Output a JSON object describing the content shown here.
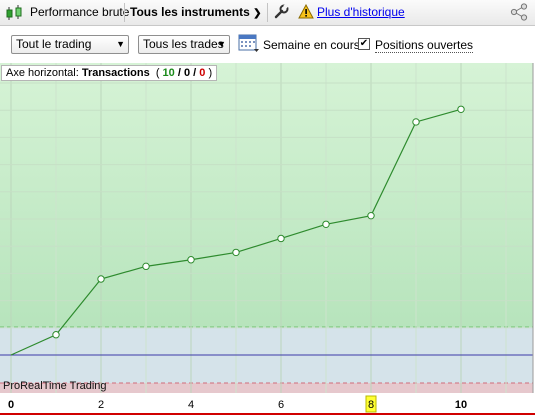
{
  "toolbar": {
    "performance_label": "Performance brute",
    "instruments_label": "Tous les instruments",
    "history_link": "Plus d'historique"
  },
  "filters": {
    "trading_select": "Tout le trading",
    "trades_select": "Tous les trades",
    "period_label": "Semaine en cours",
    "open_positions_label": "Positions ouvertes",
    "open_positions_checked": true
  },
  "legend": {
    "axis_prefix": "Axe horizontal:",
    "axis_name": "Transactions",
    "open_paren": "(",
    "wins": "10",
    "slash1": "/",
    "neutral": "0",
    "slash2": "/",
    "losses": "0",
    "close_paren": ")"
  },
  "panel_label": "ProRealTime Trading",
  "colors": {
    "win": "#1a8a1a",
    "loss": "#cc0000",
    "line": "#2e8b2e",
    "zero_line": "#3a3aa8",
    "highlight": "#ffff33"
  },
  "chart_data": {
    "type": "line",
    "title": "",
    "xlabel": "Transactions",
    "ylabel": "",
    "xlim": [
      0,
      11.5
    ],
    "ylim": [
      0,
      100
    ],
    "x_ticks": [
      "0",
      "2",
      "4",
      "6",
      "8",
      "10"
    ],
    "highlight_tick": "8",
    "series": [
      {
        "x": [
          0,
          1,
          2,
          3,
          4,
          5,
          6,
          7,
          8,
          9,
          10
        ],
        "y": [
          0,
          8,
          30,
          35,
          37.6,
          40.5,
          46,
          51.6,
          55,
          92,
          97
        ]
      }
    ]
  }
}
